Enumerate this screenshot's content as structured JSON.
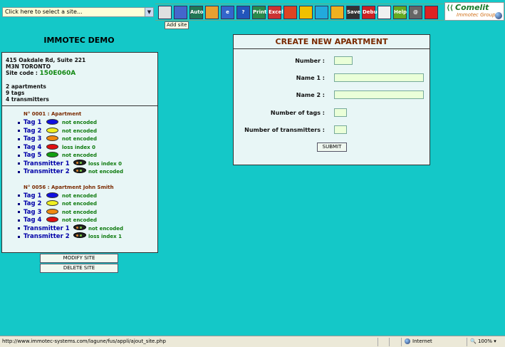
{
  "site_select": {
    "value": "Click here to select a site..."
  },
  "toolbar": {
    "tooltip": "Add site",
    "buttons": [
      {
        "icon": "building-icon",
        "label": "",
        "bg": "#e0e0e0",
        "fg": "#000"
      },
      {
        "icon": "home-icon",
        "label": "",
        "bg": "#4466cc",
        "fg": "#fff"
      },
      {
        "icon": "database-auto-icon",
        "label": "Auto",
        "bg": "#227755",
        "fg": "#fff"
      },
      {
        "icon": "search-key-icon",
        "label": "",
        "bg": "#e8a030",
        "fg": "#fff"
      },
      {
        "icon": "ie-icon",
        "label": "e",
        "bg": "#3366cc",
        "fg": "#fff"
      },
      {
        "icon": "help-icon",
        "label": "?",
        "bg": "#2255bb",
        "fg": "#fff"
      },
      {
        "icon": "print-icon",
        "label": "Print",
        "bg": "#2a8a4a",
        "fg": "#fff"
      },
      {
        "icon": "excel-icon",
        "label": "Excel",
        "bg": "#cc3333",
        "fg": "#fff"
      },
      {
        "icon": "users-icon",
        "label": "",
        "bg": "#dd4422",
        "fg": "#fff"
      },
      {
        "icon": "card-icon",
        "label": "",
        "bg": "#f0c000",
        "fg": "#000"
      },
      {
        "icon": "link-icon",
        "label": "",
        "bg": "#22aadd",
        "fg": "#fff"
      },
      {
        "icon": "notes-icon",
        "label": "",
        "bg": "#f0b020",
        "fg": "#000"
      },
      {
        "icon": "save-icon",
        "label": "Save",
        "bg": "#333333",
        "fg": "#fff"
      },
      {
        "icon": "debug-icon",
        "label": "Debug",
        "bg": "#cc2222",
        "fg": "#fff"
      },
      {
        "icon": "tools-icon",
        "label": "",
        "bg": "#f0f0f0",
        "fg": "#c00"
      },
      {
        "icon": "help-book-icon",
        "label": "Help",
        "bg": "#66aa22",
        "fg": "#fff"
      },
      {
        "icon": "email-icon",
        "label": "@",
        "bg": "#666666",
        "fg": "#fff"
      },
      {
        "icon": "power-icon",
        "label": "",
        "bg": "#dd2222",
        "fg": "#fff"
      }
    ]
  },
  "brand": {
    "name": "Comelit",
    "sub": "Immotec Group"
  },
  "site": {
    "title": "IMMOTEC DEMO",
    "address1": "415 Oakdale Rd, Suite 221",
    "address2": "M3N TORONTO",
    "code_label": "Site code :",
    "code_value": "150E060A",
    "apartments": "2 apartments",
    "tags": "9 tags",
    "transmitters": "4 transmitters"
  },
  "apartments": [
    {
      "header": "N° 0001 : Apartment",
      "items": [
        {
          "label": "Tag 1",
          "kind": "tag",
          "color": "#1010e0",
          "status": "not encoded"
        },
        {
          "label": "Tag 2",
          "kind": "tag",
          "color": "#f0f020",
          "status": "not encoded"
        },
        {
          "label": "Tag 3",
          "kind": "tag",
          "color": "#f08a10",
          "status": "not encoded"
        },
        {
          "label": "Tag 4",
          "kind": "tag",
          "color": "#e01010",
          "status": "loss index 0"
        },
        {
          "label": "Tag 5",
          "kind": "tag",
          "color": "#10a010",
          "status": "not encoded"
        },
        {
          "label": "Transmitter 1",
          "kind": "tx",
          "color": "#222222",
          "status": "loss index 0"
        },
        {
          "label": "Transmitter 2",
          "kind": "tx",
          "color": "#222222",
          "status": "not encoded"
        }
      ]
    },
    {
      "header": "N° 0056 : Apartment John Smith",
      "items": [
        {
          "label": "Tag 1",
          "kind": "tag",
          "color": "#1010e0",
          "status": "not encoded"
        },
        {
          "label": "Tag 2",
          "kind": "tag",
          "color": "#f0f020",
          "status": "not encoded"
        },
        {
          "label": "Tag 3",
          "kind": "tag",
          "color": "#f08a10",
          "status": "not encoded"
        },
        {
          "label": "Tag 4",
          "kind": "tag",
          "color": "#e01010",
          "status": "not encoded"
        },
        {
          "label": "Transmitter 1",
          "kind": "tx",
          "color": "#222222",
          "status": "not encoded"
        },
        {
          "label": "Transmitter 2",
          "kind": "tx",
          "color": "#222222",
          "status": "loss index 1"
        }
      ]
    }
  ],
  "side_buttons": {
    "modify": "MODIFY SITE",
    "delete": "DELETE SITE"
  },
  "form": {
    "title": "CREATE NEW APARTMENT",
    "number_label": "Number :",
    "name1_label": "Name 1 :",
    "name2_label": "Name 2 :",
    "tags_label": "Number of tags :",
    "tx_label": "Number of transmitters :",
    "number_value": "",
    "name1_value": "",
    "name2_value": "",
    "tags_value": "",
    "tx_value": "",
    "submit": "SUBMIT"
  },
  "statusbar": {
    "url": "http://www.immotec-systems.com/lagune/fus/appli/ajout_site.php",
    "zone": "Internet",
    "zoom": "100%"
  }
}
